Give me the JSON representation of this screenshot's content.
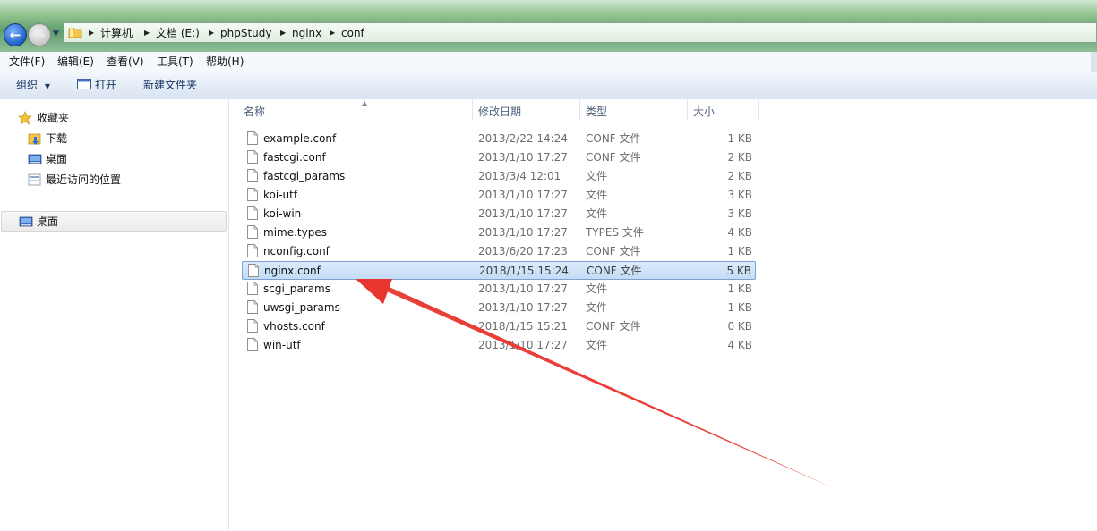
{
  "colors": {
    "arrow": "#e8352e",
    "accent": "#1e5fc8",
    "selected_row": "#cce1f8"
  },
  "icons": {
    "back": "back-arrow-icon",
    "forward": "forward-arrow-icon",
    "folder": "folder-icon",
    "breadcrumb_separator": "chevron-right-icon",
    "favorites": "star-icon",
    "downloads": "downloads-folder-icon",
    "desktop": "desktop-icon",
    "recent": "recent-places-icon",
    "file": "document-icon",
    "open": "open-icon",
    "sort": "sort-up-caret-icon",
    "annotation": "red-arrow-annotation"
  },
  "address": {
    "crumbs": [
      "计算机",
      "文档 (E:)",
      "phpStudy",
      "nginx",
      "conf"
    ]
  },
  "menu": {
    "items": [
      "文件(F)",
      "编辑(E)",
      "查看(V)",
      "工具(T)",
      "帮助(H)"
    ]
  },
  "toolbar": {
    "organize": "组织",
    "open": "打开",
    "new_folder": "新建文件夹"
  },
  "nav": {
    "favorites": "收藏夹",
    "items": [
      "下载",
      "桌面",
      "最近访问的位置"
    ],
    "desktop": "桌面"
  },
  "list": {
    "columns": {
      "name": "名称",
      "date": "修改日期",
      "type": "类型",
      "size": "大小"
    },
    "files": [
      {
        "name": "example.conf",
        "date": "2013/2/22 14:24",
        "type": "CONF 文件",
        "size": "1 KB"
      },
      {
        "name": "fastcgi.conf",
        "date": "2013/1/10 17:27",
        "type": "CONF 文件",
        "size": "2 KB"
      },
      {
        "name": "fastcgi_params",
        "date": "2013/3/4 12:01",
        "type": "文件",
        "size": "2 KB"
      },
      {
        "name": "koi-utf",
        "date": "2013/1/10 17:27",
        "type": "文件",
        "size": "3 KB"
      },
      {
        "name": "koi-win",
        "date": "2013/1/10 17:27",
        "type": "文件",
        "size": "3 KB"
      },
      {
        "name": "mime.types",
        "date": "2013/1/10 17:27",
        "type": "TYPES 文件",
        "size": "4 KB"
      },
      {
        "name": "nconfig.conf",
        "date": "2013/6/20 17:23",
        "type": "CONF 文件",
        "size": "1 KB"
      },
      {
        "name": "nginx.conf",
        "date": "2018/1/15 15:24",
        "type": "CONF 文件",
        "size": "5 KB"
      },
      {
        "name": "scgi_params",
        "date": "2013/1/10 17:27",
        "type": "文件",
        "size": "1 KB"
      },
      {
        "name": "uwsgi_params",
        "date": "2013/1/10 17:27",
        "type": "文件",
        "size": "1 KB"
      },
      {
        "name": "vhosts.conf",
        "date": "2018/1/15 15:21",
        "type": "CONF 文件",
        "size": "0 KB"
      },
      {
        "name": "win-utf",
        "date": "2013/1/10 17:27",
        "type": "文件",
        "size": "4 KB"
      }
    ]
  }
}
